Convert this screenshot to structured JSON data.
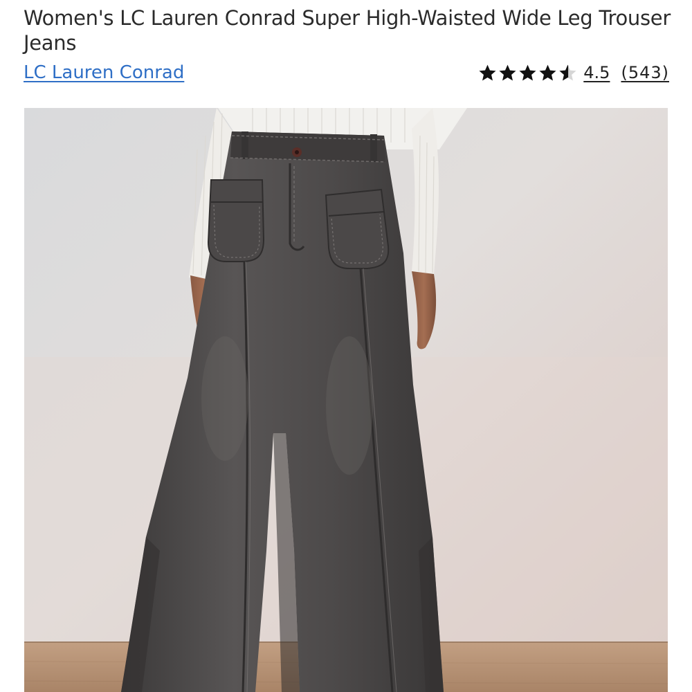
{
  "product": {
    "title": "Women's LC Lauren Conrad Super High-Waisted Wide Leg Trouser Jeans",
    "brand": "LC Lauren Conrad",
    "rating_value": "4.5",
    "rating_count": "(543)",
    "stars": [
      "star-full-icon",
      "star-full-icon",
      "star-full-icon",
      "star-full-icon",
      "star-half-icon"
    ]
  },
  "colors": {
    "link": "#2f6fc6",
    "denim": "#4a4747",
    "wall": "#dcd8d6",
    "floor": "#b89576"
  }
}
